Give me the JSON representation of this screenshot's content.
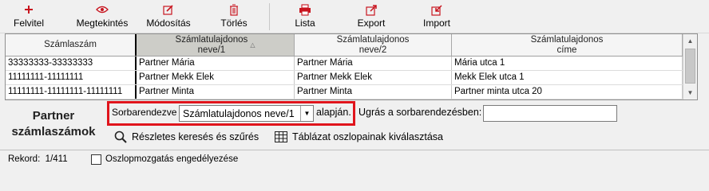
{
  "toolbar": {
    "new": {
      "label": "Felvitel",
      "icon": "plus-icon"
    },
    "view": {
      "label": "Megtekintés",
      "icon": "eye-icon"
    },
    "edit": {
      "label": "Módosítás",
      "icon": "edit-icon"
    },
    "delete": {
      "label": "Törlés",
      "icon": "trash-icon"
    },
    "list": {
      "label": "Lista",
      "icon": "printer-icon"
    },
    "export": {
      "label": "Export",
      "icon": "export-icon"
    },
    "import": {
      "label": "Import",
      "icon": "import-icon"
    }
  },
  "grid": {
    "columns": [
      "Számlaszám",
      "Számlatulajdonos\nneve/1",
      "Számlatulajdonos\nneve/2",
      "Számlatulajdonos\ncíme"
    ],
    "sorted_column": 1,
    "rows": [
      [
        "33333333-33333333",
        "Partner Mária",
        "Partner Mária",
        "Mária utca 1"
      ],
      [
        "11111111-11111111",
        "Partner Mekk Elek",
        "Partner Mekk Elek",
        "Mekk Elek utca 1"
      ],
      [
        "11111111-11111111-11111111",
        "Partner Minta",
        "Partner Minta",
        "Partner minta utca 20"
      ]
    ]
  },
  "panel": {
    "title_line1": "Partner",
    "title_line2": "számlaszámok",
    "sort_label": "Sorbarendezve",
    "sort_value": "Számlatulajdonos neve/1",
    "sort_suffix": "alapján.",
    "jump_label": "Ugrás a sorbarendezésben:",
    "jump_value": "",
    "search_filter": "Részletes keresés és szűrés",
    "column_select": "Táblázat oszlopainak kiválasztása"
  },
  "status": {
    "record_label": "Rekord:",
    "record_value": "1/411",
    "column_move_label": "Oszlopmozgatás engedélyezése",
    "column_move_checked": false
  },
  "colors": {
    "icon_red": "#c8141e",
    "highlight_border": "#e0141c",
    "sorted_header_bg": "#cdcdc8"
  }
}
